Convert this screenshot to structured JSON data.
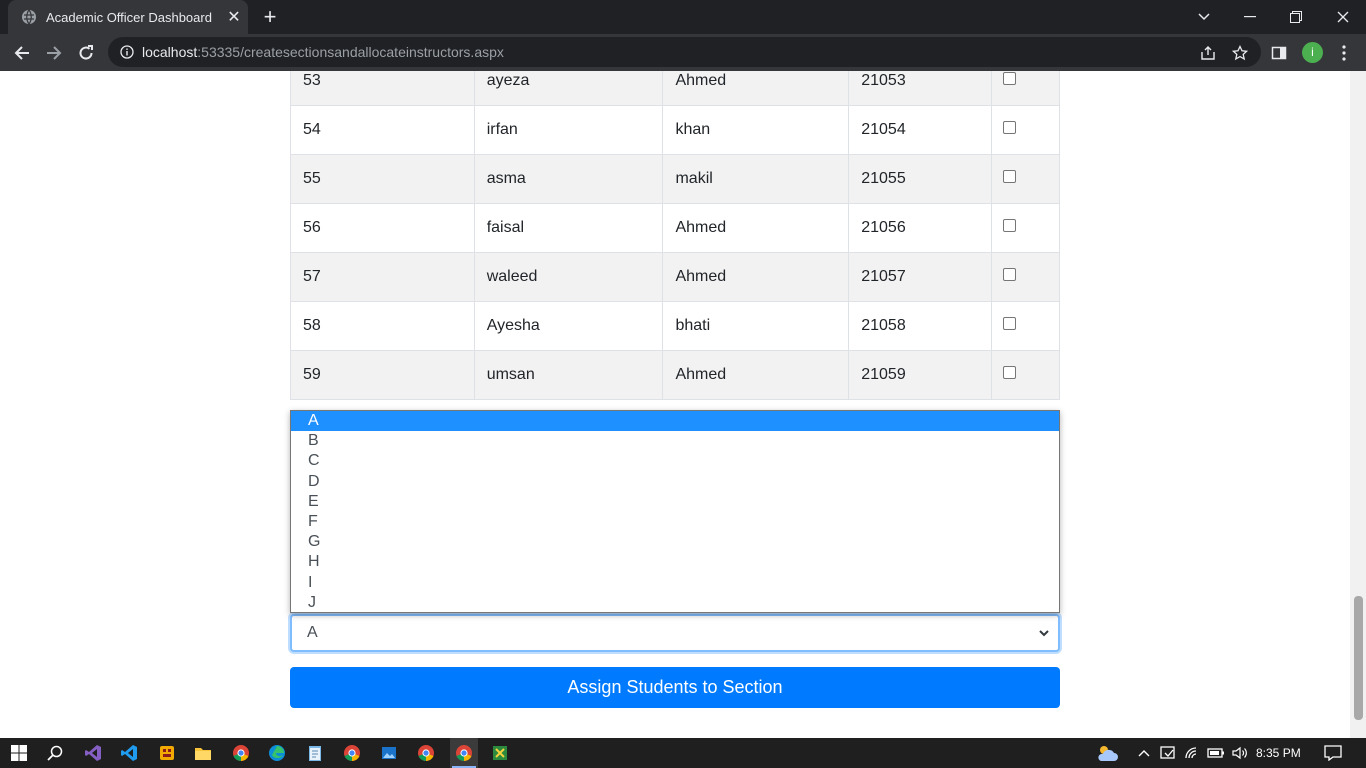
{
  "browser": {
    "tab_title": "Academic Officer Dashboard",
    "url_host": "localhost",
    "url_rest": ":53335/createsectionsandallocateinstructors.aspx",
    "profile_initial": "i"
  },
  "table": {
    "rows": [
      {
        "id": "53",
        "first": "ayeza",
        "last": "Ahmed",
        "reg": "21053",
        "checked": false
      },
      {
        "id": "54",
        "first": "irfan",
        "last": "khan",
        "reg": "21054",
        "checked": false
      },
      {
        "id": "55",
        "first": "asma",
        "last": "makil",
        "reg": "21055",
        "checked": false
      },
      {
        "id": "56",
        "first": "faisal",
        "last": "Ahmed",
        "reg": "21056",
        "checked": false
      },
      {
        "id": "57",
        "first": "waleed",
        "last": "Ahmed",
        "reg": "21057",
        "checked": false
      },
      {
        "id": "58",
        "first": "Ayesha",
        "last": "bhati",
        "reg": "21058",
        "checked": false
      },
      {
        "id": "59",
        "first": "umsan",
        "last": "Ahmed",
        "reg": "21059",
        "checked": false
      }
    ]
  },
  "section_select": {
    "selected": "A",
    "options": [
      "A",
      "B",
      "C",
      "D",
      "E",
      "F",
      "G",
      "H",
      "I",
      "J"
    ]
  },
  "assign_button_label": "Assign Students to Section",
  "taskbar": {
    "time": "8:35 PM"
  },
  "colors": {
    "primary": "#007bff",
    "option_highlight": "#1e90ff"
  }
}
